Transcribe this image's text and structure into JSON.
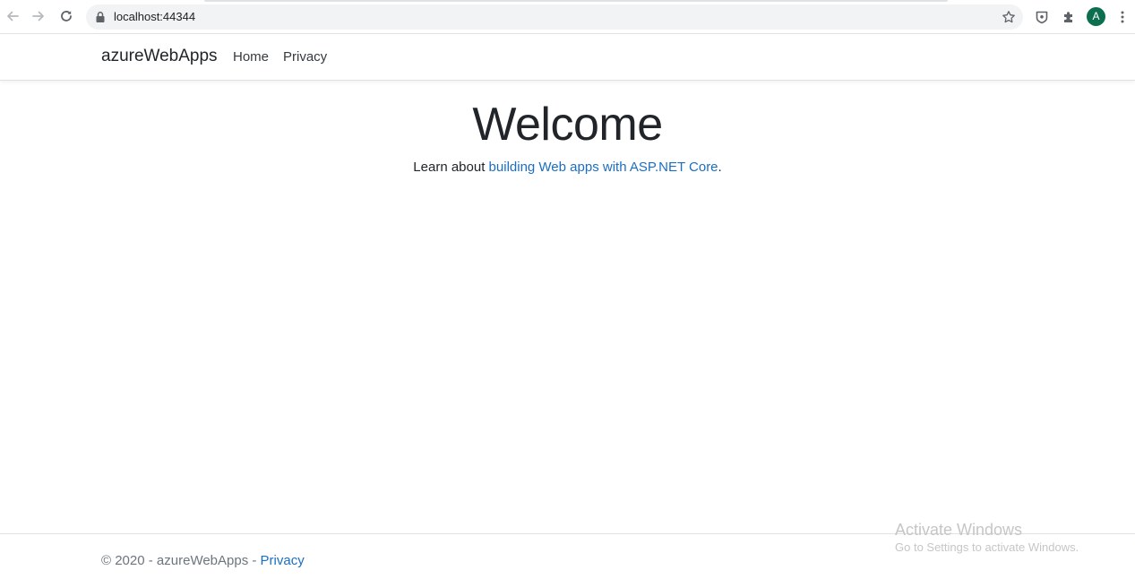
{
  "browser": {
    "url": "localhost:44344",
    "avatar_letter": "A",
    "icons": {
      "back": "arrow-left-icon",
      "forward": "arrow-right-icon",
      "reload": "reload-icon",
      "lock": "lock-icon",
      "bookmark": "star-icon",
      "extension": "shield-icon",
      "extensions_menu": "puzzle-icon",
      "menu": "kebab-menu-icon"
    }
  },
  "navbar": {
    "brand": "azureWebApps",
    "links": [
      {
        "label": "Home"
      },
      {
        "label": "Privacy"
      }
    ]
  },
  "main": {
    "title": "Welcome",
    "learn_prefix": "Learn about ",
    "learn_link": "building Web apps with ASP.NET Core",
    "learn_suffix": "."
  },
  "footer": {
    "text": "© 2020 - azureWebApps - ",
    "privacy_link": "Privacy"
  },
  "watermark": {
    "title": "Activate Windows",
    "subtitle": "Go to Settings to activate Windows."
  },
  "colors": {
    "link": "#1b6ec2",
    "avatar": "#0b6e4f",
    "text": "#212529",
    "muted": "#6c757d",
    "omnibox": "#f1f3f4"
  }
}
